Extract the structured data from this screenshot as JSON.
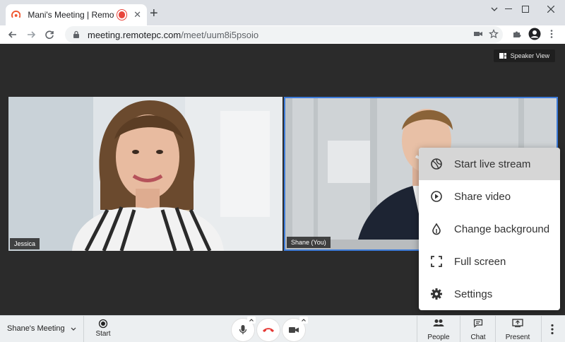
{
  "browser": {
    "tab_title": "Mani's Meeting | RemotePC",
    "tab_close": "✕",
    "new_tab": "+",
    "url_host": "meeting.remotepc.com",
    "url_path": "/meet/uum8i5psoio"
  },
  "stage": {
    "speaker_view_label": "Speaker View",
    "participants": [
      {
        "name": "Jessica"
      },
      {
        "name": "Shane (You)"
      }
    ]
  },
  "menu": {
    "items": [
      {
        "label": "Start live stream",
        "icon": "broadcast-icon"
      },
      {
        "label": "Share video",
        "icon": "play-circle-icon"
      },
      {
        "label": "Change background",
        "icon": "droplet-icon"
      },
      {
        "label": "Full screen",
        "icon": "fullscreen-icon"
      },
      {
        "label": "Settings",
        "icon": "gear-icon"
      }
    ]
  },
  "bottom": {
    "meeting_name": "Shane's Meeting",
    "start_label": "Start",
    "people_label": "People",
    "chat_label": "Chat",
    "present_label": "Present"
  },
  "colors": {
    "accent_border": "#3d7bd9",
    "end_call": "#e53935"
  }
}
